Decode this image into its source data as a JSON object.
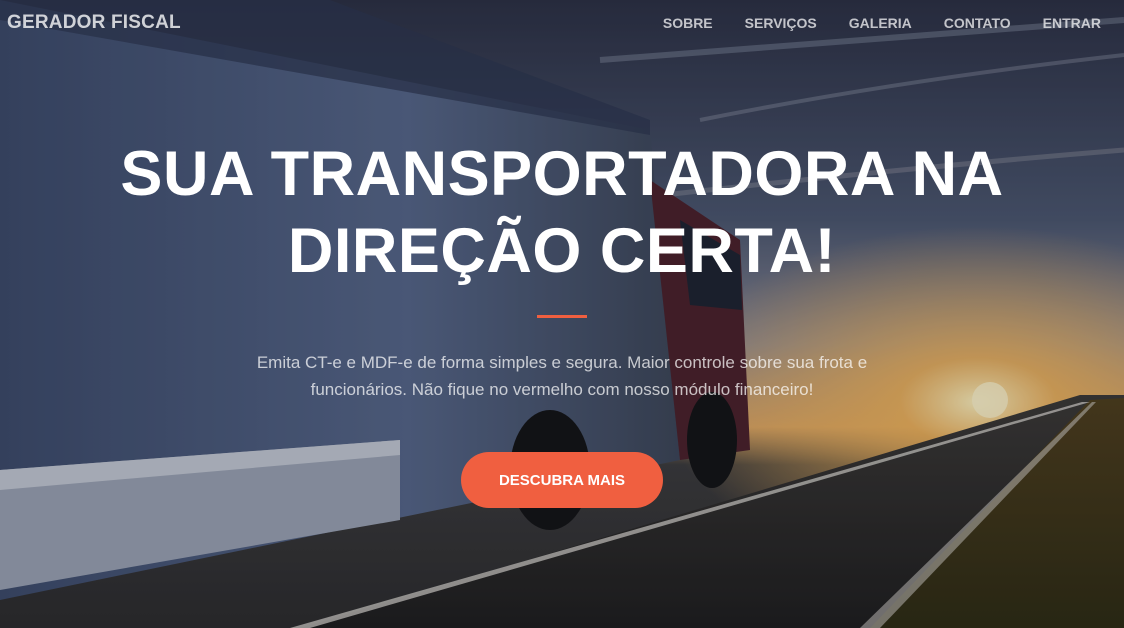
{
  "navbar": {
    "brand": "GERADOR FISCAL",
    "links": [
      {
        "label": "SOBRE"
      },
      {
        "label": "SERVIÇOS"
      },
      {
        "label": "GALERIA"
      },
      {
        "label": "CONTATO"
      },
      {
        "label": "ENTRAR"
      }
    ]
  },
  "hero": {
    "headline_line1": "SUA TRANSPORTADORA NA",
    "headline_line2": "DIREÇÃO CERTA!",
    "lead_line1": "Emita CT-e e MDF-e de forma simples e segura. Maior controle sobre sua frota e",
    "lead_line2": "funcionários. Não fique no vermelho com nosso módulo financeiro!",
    "cta_label": "DESCUBRA MAIS",
    "background_image": "truck-on-highway-at-sunset"
  },
  "colors": {
    "accent": "#f05f40",
    "text_light": "#ffffff"
  }
}
